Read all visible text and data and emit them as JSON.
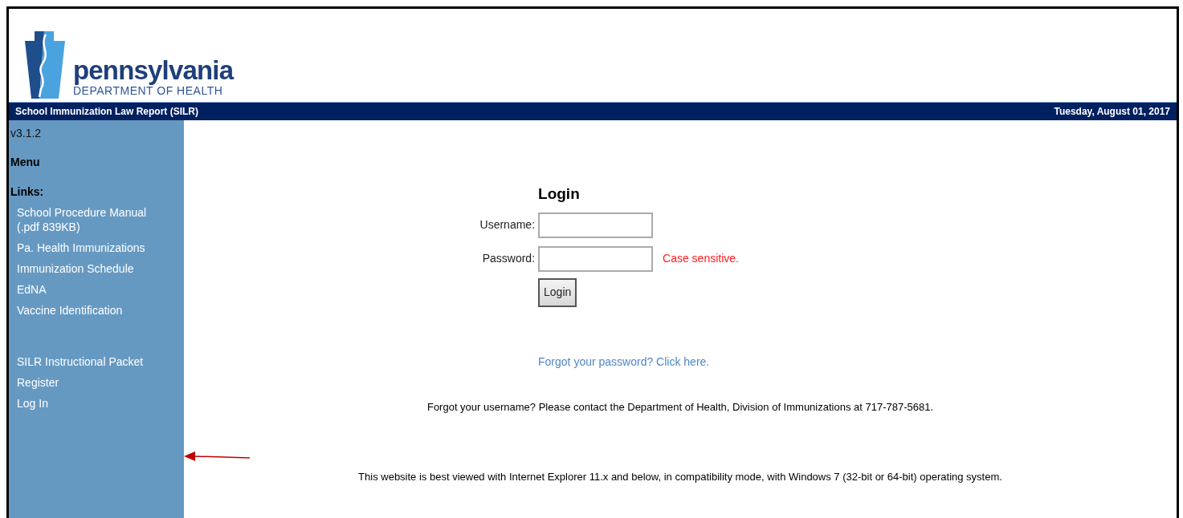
{
  "logo": {
    "name": "pennsylvania",
    "subtitle": "DEPARTMENT OF HEALTH"
  },
  "title_bar": {
    "title": "School Immunization Law Report (SILR)",
    "date": "Tuesday, August 01, 2017"
  },
  "sidebar": {
    "version": "v3.1.2",
    "menu_heading": "Menu",
    "links_heading": "Links:",
    "link_groups": [
      [
        "School Procedure Manual (.pdf 839KB)",
        "Pa. Health Immunizations",
        "Immunization Schedule",
        "EdNA",
        "Vaccine Identification"
      ],
      [
        "SILR Instructional Packet",
        "Register",
        "Log In"
      ]
    ]
  },
  "login": {
    "title": "Login",
    "fields": [
      {
        "label": "Username:"
      },
      {
        "label": "Password:",
        "hint": "Case sensitive."
      }
    ],
    "button": "Login",
    "forgot_password_link": "Forgot your password? Click here.",
    "username_help": "Forgot your username?  Please contact the Department of Health, Division of Immunizations at 717-787-5681.",
    "browser_note": "This website is best viewed with Internet Explorer 11.x and below, in compatibility mode, with Windows 7 (32-bit or 64-bit) operating system."
  }
}
